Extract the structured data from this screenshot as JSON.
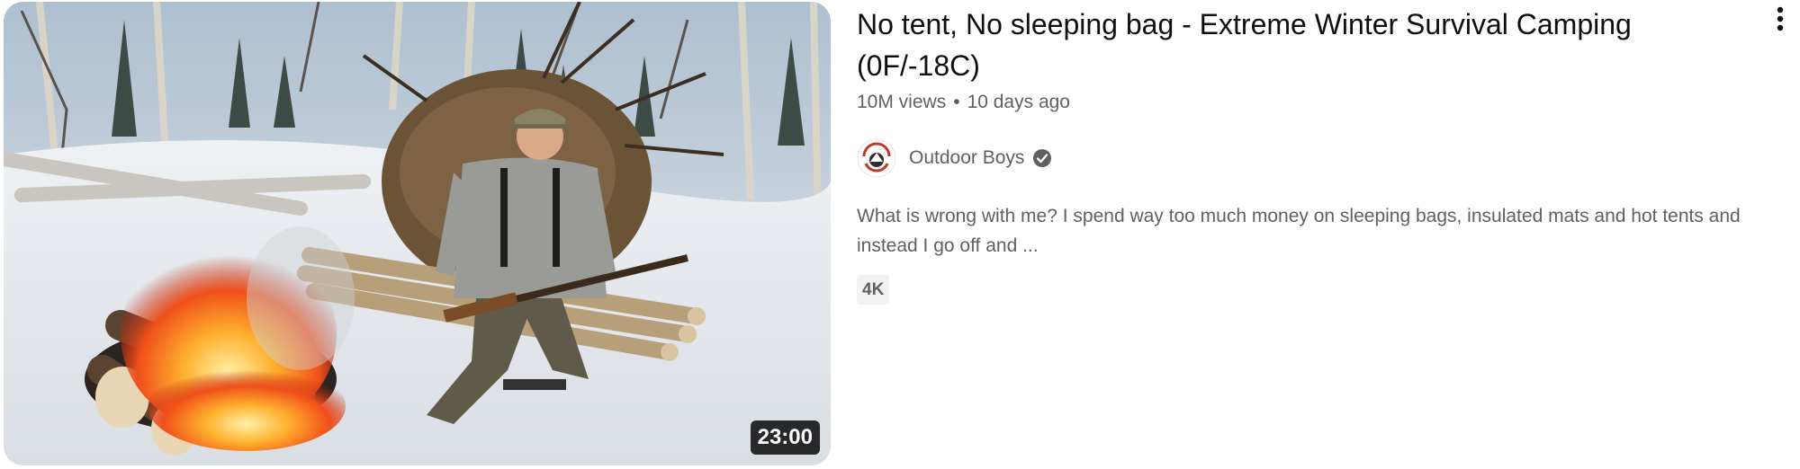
{
  "video": {
    "title": "No tent, No sleeping bag - Extreme Winter Survival Camping (0F/-18C)",
    "views": "10M views",
    "separator": "•",
    "age": "10 days ago",
    "duration": "23:00",
    "description": "What is wrong with me? I spend way too much money on sleeping bags, insulated mats and hot tents and instead I go off and ...",
    "badge": "4K",
    "thumbnail_alt": "Man sitting on a log bench beside a campfire in snowy forest"
  },
  "channel": {
    "name": "Outdoor Boys",
    "verified": true,
    "avatar_text": "OUTDOOR BOYS"
  },
  "icons": {
    "verified": "verified-check-icon",
    "menu": "more-vertical-icon"
  },
  "colors": {
    "text_primary": "#0f0f0f",
    "text_secondary": "#606060",
    "badge_bg": "#f2f2f2",
    "duration_bg": "#000000"
  }
}
